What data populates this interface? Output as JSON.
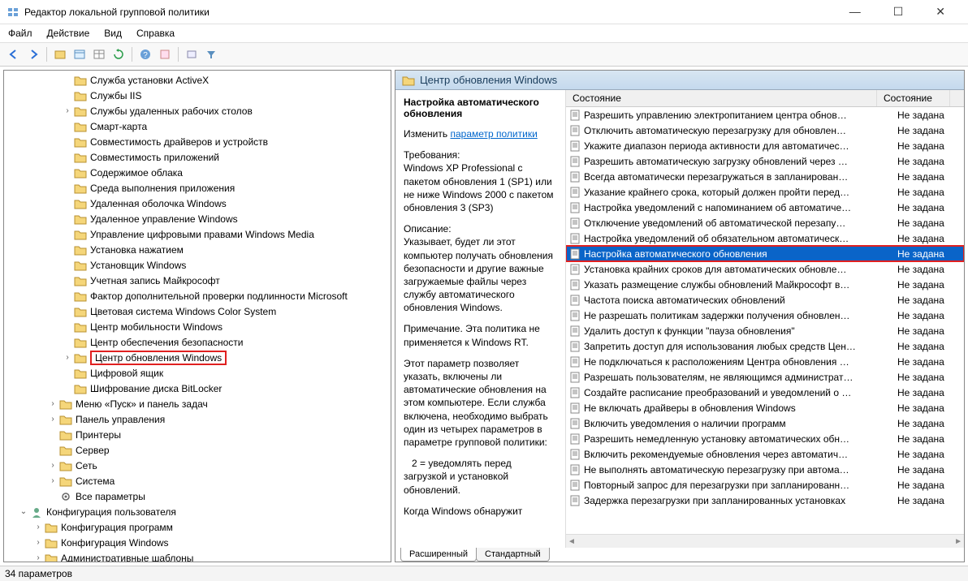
{
  "window": {
    "title": "Редактор локальной групповой политики",
    "menu": [
      "Файл",
      "Действие",
      "Вид",
      "Справка"
    ]
  },
  "tree": {
    "items": [
      {
        "indent": 4,
        "exp": "",
        "label": "Служба установки ActiveX"
      },
      {
        "indent": 4,
        "exp": "",
        "label": "Службы IIS"
      },
      {
        "indent": 4,
        "exp": ">",
        "label": "Службы удаленных рабочих столов"
      },
      {
        "indent": 4,
        "exp": "",
        "label": "Смарт-карта"
      },
      {
        "indent": 4,
        "exp": "",
        "label": "Совместимость драйверов и устройств"
      },
      {
        "indent": 4,
        "exp": "",
        "label": "Совместимость приложений"
      },
      {
        "indent": 4,
        "exp": "",
        "label": "Содержимое облака"
      },
      {
        "indent": 4,
        "exp": "",
        "label": "Среда выполнения приложения"
      },
      {
        "indent": 4,
        "exp": "",
        "label": "Удаленная оболочка Windows"
      },
      {
        "indent": 4,
        "exp": "",
        "label": "Удаленное управление Windows"
      },
      {
        "indent": 4,
        "exp": "",
        "label": "Управление цифровыми правами Windows Media"
      },
      {
        "indent": 4,
        "exp": "",
        "label": "Установка нажатием"
      },
      {
        "indent": 4,
        "exp": "",
        "label": "Установщик Windows"
      },
      {
        "indent": 4,
        "exp": "",
        "label": "Учетная запись Майкрософт"
      },
      {
        "indent": 4,
        "exp": "",
        "label": "Фактор дополнительной проверки подлинности Microsoft"
      },
      {
        "indent": 4,
        "exp": "",
        "label": "Цветовая система Windows Color System"
      },
      {
        "indent": 4,
        "exp": "",
        "label": "Центр мобильности Windows"
      },
      {
        "indent": 4,
        "exp": "",
        "label": "Центр обеспечения безопасности"
      },
      {
        "indent": 4,
        "exp": ">",
        "label": "Центр обновления Windows",
        "hl": true
      },
      {
        "indent": 4,
        "exp": "",
        "label": "Цифровой ящик"
      },
      {
        "indent": 4,
        "exp": "",
        "label": "Шифрование диска BitLocker"
      },
      {
        "indent": 3,
        "exp": ">",
        "label": "Меню «Пуск» и панель задач"
      },
      {
        "indent": 3,
        "exp": ">",
        "label": "Панель управления"
      },
      {
        "indent": 3,
        "exp": "",
        "label": "Принтеры"
      },
      {
        "indent": 3,
        "exp": "",
        "label": "Сервер"
      },
      {
        "indent": 3,
        "exp": ">",
        "label": "Сеть"
      },
      {
        "indent": 3,
        "exp": ">",
        "label": "Система"
      },
      {
        "indent": 3,
        "exp": "",
        "label": "Все параметры",
        "icon": "gear"
      },
      {
        "indent": 1,
        "exp": "v",
        "label": "Конфигурация пользователя",
        "icon": "user"
      },
      {
        "indent": 2,
        "exp": ">",
        "label": "Конфигурация программ"
      },
      {
        "indent": 2,
        "exp": ">",
        "label": "Конфигурация Windows"
      },
      {
        "indent": 2,
        "exp": ">",
        "label": "Административные шаблоны"
      }
    ]
  },
  "right_header": "Центр обновления Windows",
  "desc": {
    "title": "Настройка автоматического обновления",
    "edit_prefix": "Изменить ",
    "edit_link": "параметр политики",
    "req_label": "Требования:",
    "req_text": "Windows XP Professional с пакетом обновления 1 (SP1) или не ниже Windows 2000 с пакетом обновления 3 (SP3)",
    "desc_label": "Описание:",
    "desc_text": "Указывает, будет ли этот компьютер получать обновления безопасности и другие важные загружаемые файлы через службу автоматического обновления Windows.",
    "note": "Примечание. Эта политика не применяется к Windows RT.",
    "para2": "Этот параметр позволяет указать, включены ли автоматические обновления на этом компьютере. Если служба включена, необходимо выбрать один из четырех параметров в параметре групповой политики:",
    "opt2": "2 = уведомлять перед загрузкой и установкой обновлений.",
    "trail": "Когда Windows обнаружит"
  },
  "list": {
    "col1": "Состояние",
    "col2": "Состояние",
    "state_default": "Не задана",
    "rows": [
      {
        "name": "Разрешить управлению электропитанием центра обнов…"
      },
      {
        "name": "Отключить автоматическую перезагрузку для обновлен…"
      },
      {
        "name": "Укажите диапазон периода активности для автоматичес…"
      },
      {
        "name": "Разрешить автоматическую загрузку обновлений через …"
      },
      {
        "name": "Всегда автоматически перезагружаться в запланирован…"
      },
      {
        "name": "Указание крайнего срока, который должен пройти перед…"
      },
      {
        "name": "Настройка уведомлений с напоминанием об автоматиче…"
      },
      {
        "name": "Отключение уведомлений об автоматической перезапу…"
      },
      {
        "name": "Настройка уведомлений об обязательном автоматическ…"
      },
      {
        "name": "Настройка автоматического обновления",
        "selected": true
      },
      {
        "name": "Установка крайних сроков для автоматических обновле…"
      },
      {
        "name": "Указать размещение службы обновлений Майкрософт в…"
      },
      {
        "name": "Частота поиска автоматических обновлений"
      },
      {
        "name": "Не разрешать политикам задержки получения обновлен…"
      },
      {
        "name": "Удалить доступ к функции \"пауза обновления\""
      },
      {
        "name": "Запретить доступ для использования любых средств Цен…"
      },
      {
        "name": "Не подключаться к расположениям Центра обновления …"
      },
      {
        "name": "Разрешать пользователям, не являющимся администрат…"
      },
      {
        "name": "Создайте расписание преобразований и уведомлений о …"
      },
      {
        "name": "Не включать драйверы в обновления Windows"
      },
      {
        "name": "Включить уведомления о наличии программ"
      },
      {
        "name": "Разрешить немедленную установку автоматических обн…"
      },
      {
        "name": "Включить рекомендуемые обновления через автоматич…"
      },
      {
        "name": "Не выполнять автоматическую перезагрузку при автома…"
      },
      {
        "name": "Повторный запрос для перезагрузки при запланированн…"
      },
      {
        "name": "Задержка перезагрузки при запланированных установках"
      }
    ]
  },
  "tabs": {
    "extended": "Расширенный",
    "standard": "Стандартный"
  },
  "status": "34 параметров"
}
